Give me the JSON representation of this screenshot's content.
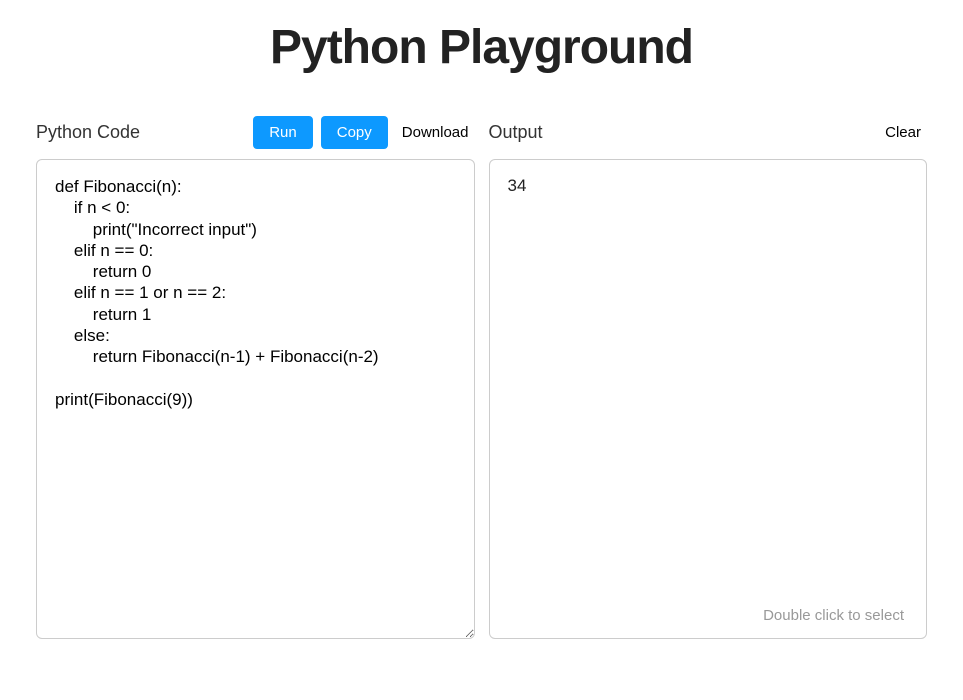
{
  "title": "Python Playground",
  "left": {
    "heading": "Python Code",
    "run_label": "Run",
    "copy_label": "Copy",
    "download_label": "Download",
    "code": "def Fibonacci(n):\n    if n < 0:\n        print(\"Incorrect input\")\n    elif n == 0:\n        return 0\n    elif n == 1 or n == 2:\n        return 1\n    else:\n        return Fibonacci(n-1) + Fibonacci(n-2)\n\nprint(Fibonacci(9))"
  },
  "right": {
    "heading": "Output",
    "clear_label": "Clear",
    "output": "34",
    "hint": "Double click to select"
  }
}
